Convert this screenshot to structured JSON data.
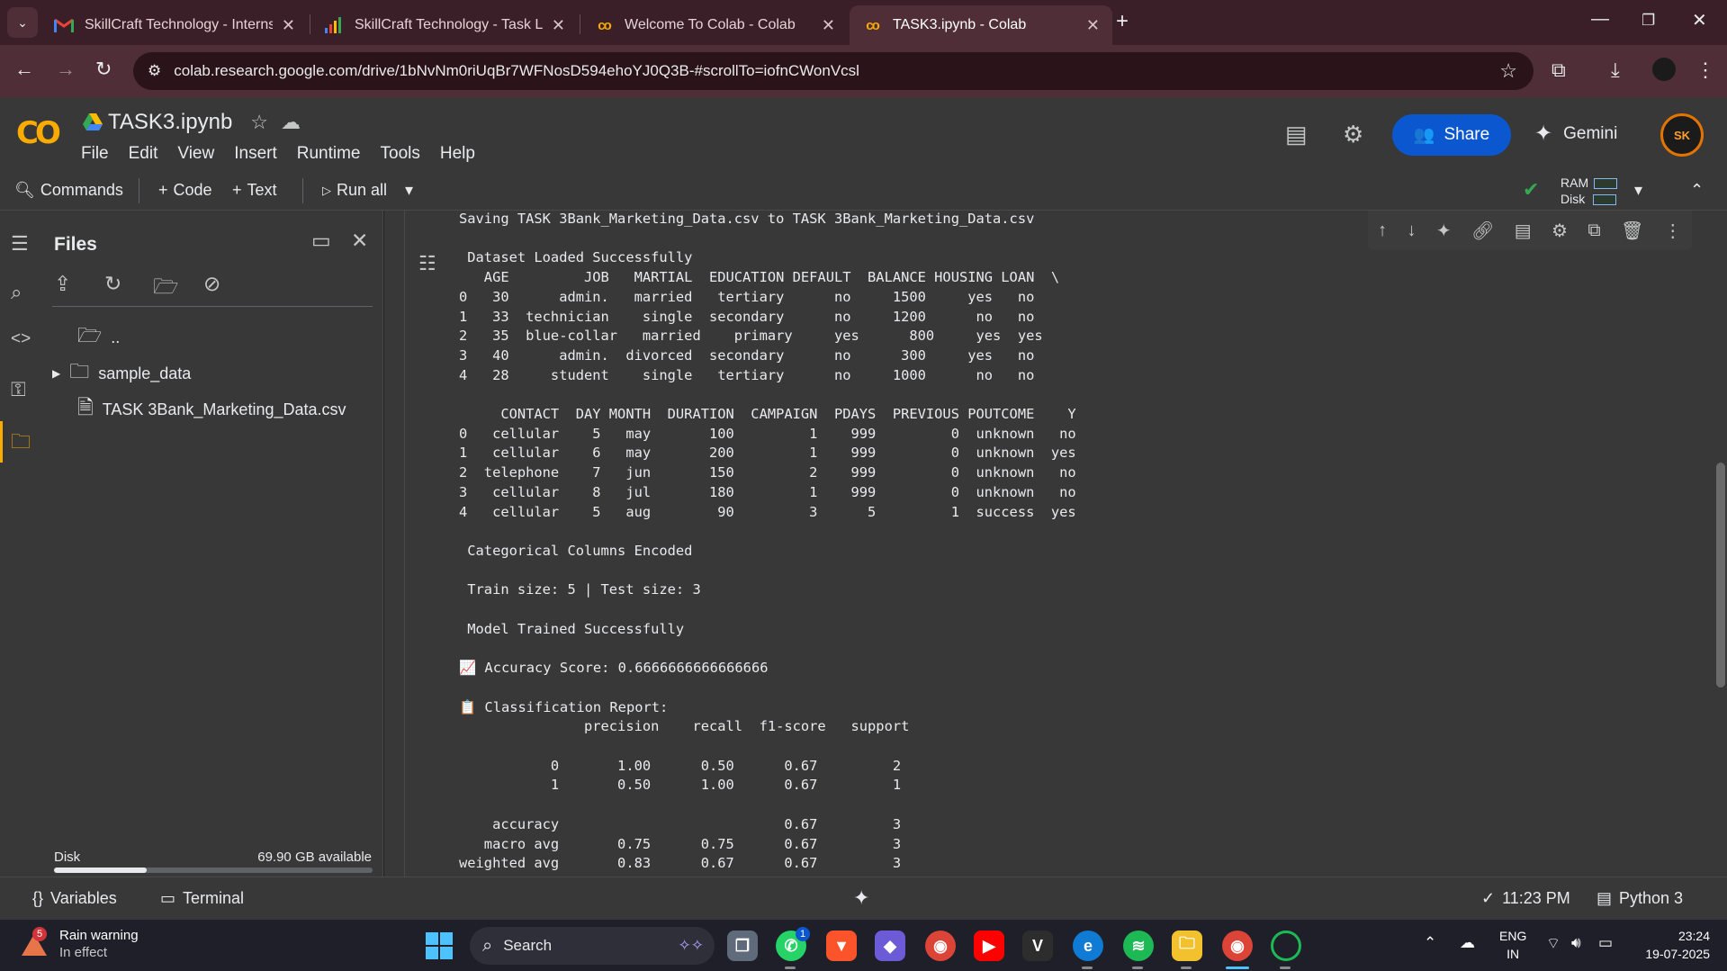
{
  "browser": {
    "tabs": [
      {
        "title": "SkillCraft Technology - Internsh",
        "favicon": "gmail-icon",
        "active": false
      },
      {
        "title": "SkillCraft Technology - Task List",
        "favicon": "chart-icon",
        "active": false
      },
      {
        "title": "Welcome To Colab - Colab",
        "favicon": "colab-icon",
        "active": false
      },
      {
        "title": "TASK3.ipynb - Colab",
        "favicon": "colab-icon",
        "active": true
      }
    ],
    "url": "colab.research.google.com/drive/1bNvNm0riUqBr7WFNosD594ehoYJ0Q3B-#scrollTo=iofnCWonVcsl"
  },
  "colab": {
    "logo": "CO",
    "notebook_title": "TASK3.ipynb",
    "menu": [
      "File",
      "Edit",
      "View",
      "Insert",
      "Runtime",
      "Tools",
      "Help"
    ],
    "share_label": "Share",
    "gemini_label": "Gemini",
    "avatar_text": "SK",
    "toolbar": {
      "commands": "Commands",
      "code": "Code",
      "text": "Text",
      "run_all": "Run all",
      "ram": "RAM",
      "disk": "Disk"
    }
  },
  "files_panel": {
    "title": "Files",
    "items": [
      {
        "name": "..",
        "type": "parent-folder"
      },
      {
        "name": "sample_data",
        "type": "folder"
      },
      {
        "name": "TASK 3Bank_Marketing_Data.csv",
        "type": "file"
      }
    ],
    "disk_label": "Disk",
    "disk_available": "69.90 GB available",
    "disk_used_fraction": 0.29
  },
  "output_lines": [
    "Saving TASK 3Bank_Marketing_Data.csv to TASK 3Bank_Marketing_Data.csv",
    "",
    " Dataset Loaded Successfully",
    "   AGE         JOB   MARTIAL  EDUCATION DEFAULT  BALANCE HOUSING LOAN  \\",
    "0   30      admin.   married   tertiary      no     1500     yes   no",
    "1   33  technician    single  secondary      no     1200      no   no",
    "2   35  blue-collar   married    primary     yes      800     yes  yes",
    "3   40      admin.  divorced  secondary      no      300     yes   no",
    "4   28     student    single   tertiary      no     1000      no   no",
    "",
    "     CONTACT  DAY MONTH  DURATION  CAMPAIGN  PDAYS  PREVIOUS POUTCOME    Y",
    "0   cellular    5   may       100         1    999         0  unknown   no",
    "1   cellular    6   may       200         1    999         0  unknown  yes",
    "2  telephone    7   jun       150         2    999         0  unknown   no",
    "3   cellular    8   jul       180         1    999         0  unknown   no",
    "4   cellular    5   aug        90         3      5         1  success  yes",
    "",
    " Categorical Columns Encoded",
    "",
    " Train size: 5 | Test size: 3",
    "",
    " Model Trained Successfully",
    "",
    "📈 Accuracy Score: 0.6666666666666666",
    "",
    "📋 Classification Report:",
    "               precision    recall  f1-score   support",
    "",
    "           0       1.00      0.50      0.67         2",
    "           1       0.50      1.00      0.67         1",
    "",
    "    accuracy                           0.67         3",
    "   macro avg       0.75      0.75      0.67         3",
    "weighted avg       0.83      0.67      0.67         3"
  ],
  "statusbar": {
    "variables": "Variables",
    "terminal": "Terminal",
    "time": "11:23 PM",
    "runtime": "Python 3"
  },
  "taskbar": {
    "weather_badge": "5",
    "weather_title": "Rain warning",
    "weather_sub": "In effect",
    "search_placeholder": "Search",
    "whatsapp_badge": "1",
    "lang_top": "ENG",
    "lang_bottom": "IN",
    "clock_time": "23:24",
    "clock_date": "19-07-2025"
  }
}
